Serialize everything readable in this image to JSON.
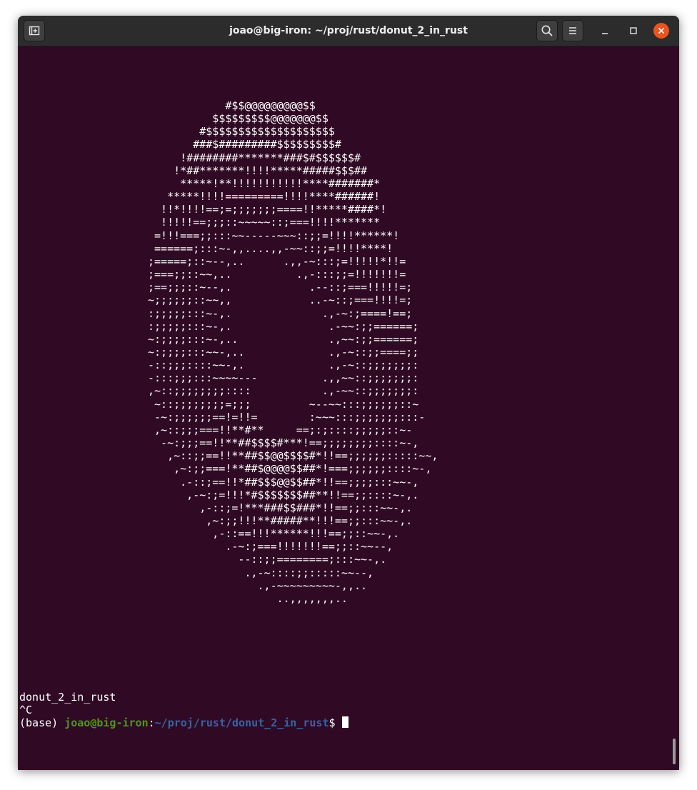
{
  "window": {
    "title": "joao@big-iron: ~/proj/rust/donut_2_in_rust"
  },
  "icons": {
    "new_tab": "new-tab-icon",
    "search": "search-icon",
    "menu": "hamburger-menu-icon",
    "minimize": "minimize-icon",
    "maximize": "maximize-icon",
    "close": "close-icon"
  },
  "colors": {
    "terminal_bg": "#300a24",
    "titlebar_bg": "#2c2c2c",
    "prompt_user": "#4e9a06",
    "prompt_path": "#3465a4",
    "close_button": "#e95420"
  },
  "terminal": {
    "donut_lines": [
      "            #$$@@@@@@@@@$$",
      "          $$$$$$$$$@@@@@@@$$",
      "        #$$$$$$$$$$$$$$$$$$$$",
      "       ###$#########$$$$$$$$$#",
      "     !########*******###$#$$$$$$#",
      "    !*##*******!!!!*****#####$$$##",
      "     *****!**!!!!!!!!!!!****#######*",
      "   *****!!!!=========!!!!****######!",
      "  !!*!!!!==;=;;;;;;;====!!*****####*!",
      "  !!!!!==;;;::~~~~~::;===!!!!*******",
      " =!!!===;;:::~~-----~~~::;;=!!!!******!",
      " ======;:::~-,,....,,-~~::;;=!!!!****!",
      ";=====;::~--,..      .,,-~:::;=!!!!!*!!=",
      ";===;;::~~,..          .,-:::;;=!!!!!!!=",
      ";==;;;::~--,.            .--::;===!!!!!=;",
      "~;;;;;;::~~,,            ..-~::;===!!!!=;",
      ":;;;;;:::~-,.              .,-~:;====!==;",
      ":;;;;;:::~-,.               .-~~:;;======;",
      "~:;;;;:::~-,..              .,~~:;;======;",
      "~:;;;;:::~~-,..             .,-~::;;====;;",
      "-::;;;::::~~-,.             .,-~::;;;;;;;:",
      "-:::;;;:::~~~~---          .,,~~::;;;;;;;:",
      ",~::;;;;;;;;::::           .,-~~::;;;;;;;:",
      " ~::;;;;;;;;=;;;         ~--~~:::;;;;;;::~",
      " -~:;;;;;;==!=!!=        :~~~:::;;;;;;;:::-",
      " ,~::;;;===!!**#**     ==;:;::::;;;;;::~-",
      "  -~:;;;==!!**##$$$$#***!==;;;;;;;;::::~-,",
      "   ,~::;;==!!**##$$@@$$$$#*!!==;;;;;;:::::~~,",
      "    ,~:;;===!**##$@@@@$$##*!===;;;;;;::::~-,",
      "     .-::;==!!*##$$$@@$$##*!!==;;;;:::~~-,",
      "      ,-~:;=!!!*#$$$$$$$##**!!==;;::::~-,.",
      "        ,-::;=!***###$$###*!!==;;:::~~-,.",
      "         ,~:;;!!!**#####**!!!==;;:::~~-,.",
      "          ,-::==!!!******!!!==;;::~~-,.",
      "            .-~:;===!!!!!!!==;;::~~--,",
      "              --::;;========;:::~~-,.",
      "               .,-~::::;;:::::~~--,",
      "                 .,-~~~~~~~~~-,,..",
      "                    ..,,,,,,,.."
    ],
    "output_lines": [
      "donut_2_in_rust",
      "^C"
    ],
    "prompt": {
      "env": "(base) ",
      "user_host": "joao@big-iron",
      "separator": ":",
      "path": "~/proj/rust/donut_2_in_rust",
      "symbol": "$ "
    }
  }
}
